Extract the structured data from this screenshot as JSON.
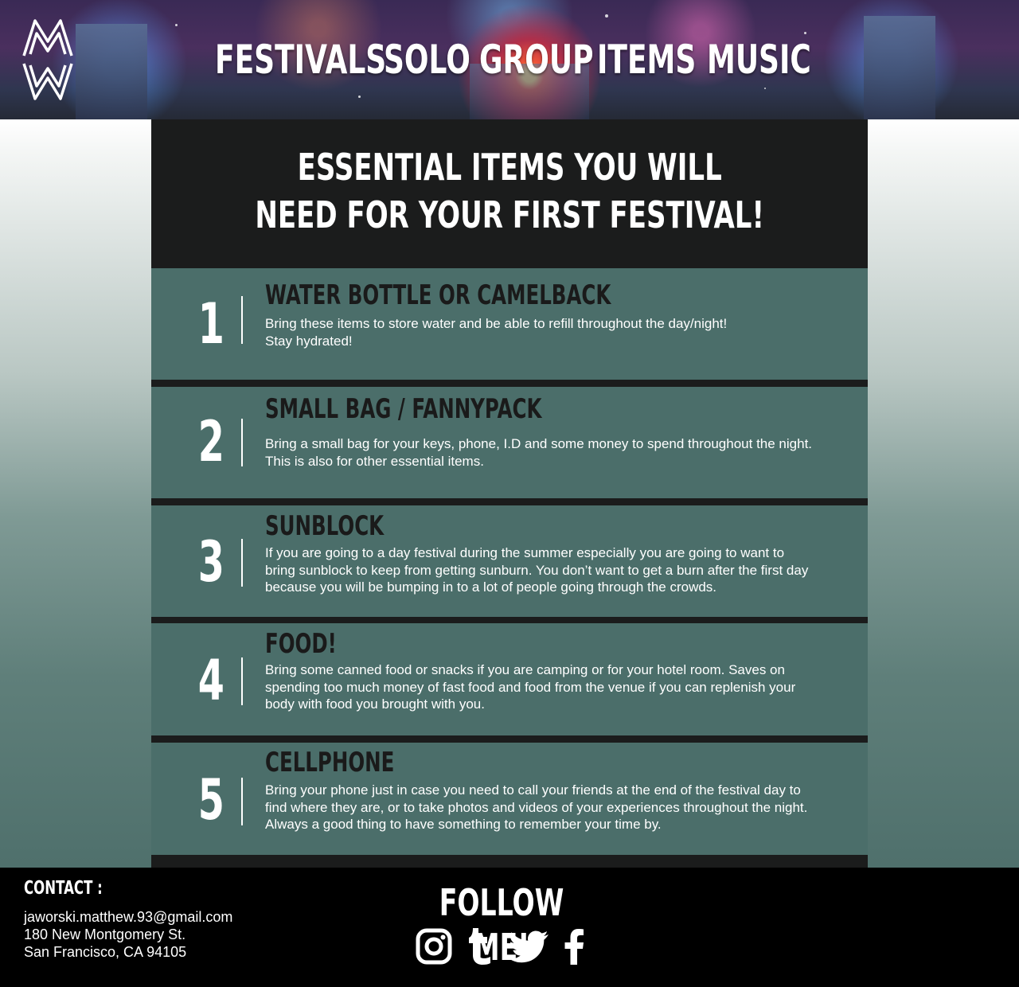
{
  "nav": {
    "items": [
      "FESTIVALS",
      "SOLO",
      "GROUP",
      "ITEMS",
      "MUSIC"
    ]
  },
  "main": {
    "title_line1": "ESSENTIAL ITEMS YOU WILL",
    "title_line2": "NEED FOR YOUR FIRST FESTIVAL!",
    "items": [
      {
        "number": "1",
        "heading": "WATER BOTTLE OR CAMELBACK",
        "lines": [
          "Bring these items to store water and be able to refill throughout the day/night!",
          "Stay hydrated!"
        ]
      },
      {
        "number": "2",
        "heading": "SMALL BAG / FANNYPACK",
        "lines": [
          "Bring a small bag for your keys, phone, I.D and some money to spend throughout the night.",
          "This is also for other essential items."
        ]
      },
      {
        "number": "3",
        "heading": "SUNBLOCK",
        "lines": [
          "If you are going to a day festival during the summer especially you are going to want to",
          "bring sunblock to keep from getting sunburn. You don’t want to get a burn after the first day",
          "because you will be bumping in to a lot of people going through the crowds."
        ]
      },
      {
        "number": "4",
        "heading": "FOOD!",
        "lines": [
          "Bring some canned food or snacks if you are camping or for your hotel room. Saves on",
          "spending too much money of fast food and food from the venue if you can replenish your",
          "body with food you brought with you."
        ]
      },
      {
        "number": "5",
        "heading": "CELLPHONE",
        "lines": [
          "Bring your phone just in case you need to call your friends at the end of the festival day to",
          "find where they are, or to take photos and videos of your experiences throughout the night.",
          "Always a good thing to have something to remember your time by."
        ]
      }
    ]
  },
  "footer": {
    "contact_label": "CONTACT :",
    "email": "jaworski.matthew.93@gmail.com",
    "address_line1": "180 New Montgomery St.",
    "address_line2": "San Francisco, CA 94105",
    "follow_label": "FOLLOW ME!",
    "social_icons": [
      "instagram-icon",
      "tumblr-icon",
      "twitter-icon",
      "facebook-icon"
    ]
  },
  "colors": {
    "panel_dark": "#1b1c1c",
    "item_teal": "#4b6e6a",
    "footer_bg": "#000000",
    "text_white": "#ffffff",
    "heading_dark": "#1a1a1a"
  }
}
